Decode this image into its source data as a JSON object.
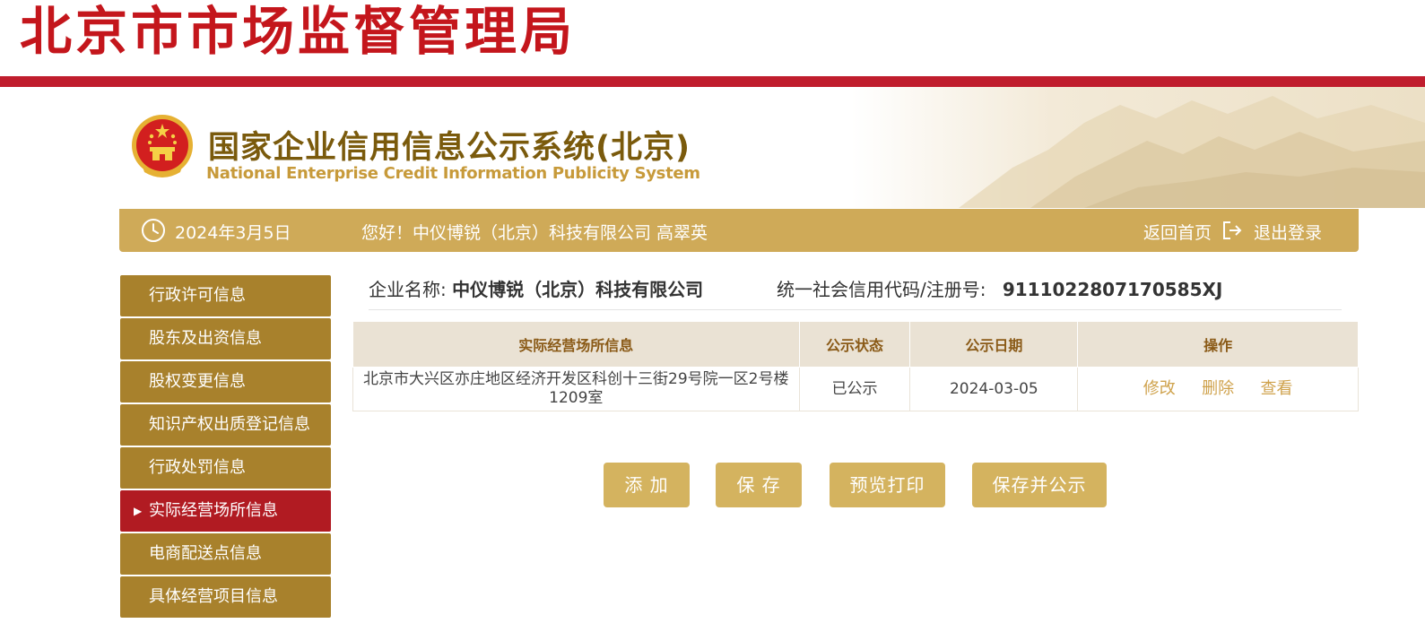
{
  "header": {
    "agency_title": "北京市市场监督管理局",
    "system_title": "国家企业信用信息公示系统(北京)",
    "system_subtitle": "National Enterprise Credit Information Publicity System"
  },
  "infobar": {
    "date": "2024年3月5日",
    "greeting": "您好！中仪博锐（北京）科技有限公司  高翠英",
    "home_link": "返回首页",
    "logout_link": "退出登录",
    "icons": [
      "clock-icon",
      "logout-icon"
    ]
  },
  "sidebar": {
    "items": [
      {
        "label": "行政许可信息"
      },
      {
        "label": "股东及出资信息"
      },
      {
        "label": "股权变更信息"
      },
      {
        "label": "知识产权出质登记信息"
      },
      {
        "label": "行政处罚信息"
      },
      {
        "label": "实际经营场所信息",
        "active": true
      },
      {
        "label": "电商配送点信息"
      },
      {
        "label": "具体经营项目信息"
      }
    ]
  },
  "company": {
    "name_label": "企业名称:",
    "name_value": "中仪博锐（北京）科技有限公司",
    "credit_label": "统一社会信用代码/注册号:",
    "credit_value": "9111022807170585XJ"
  },
  "table": {
    "headers": [
      "实际经营场所信息",
      "公示状态",
      "公示日期",
      "操作"
    ],
    "rows": [
      {
        "address": "北京市大兴区亦庄地区经济开发区科创十三街29号院一区2号楼1209室",
        "status": "已公示",
        "date": "2024-03-05",
        "actions": [
          "修改",
          "删除",
          "查看"
        ]
      }
    ]
  },
  "buttons": {
    "add": "添 加",
    "save": "保 存",
    "preview_print": "预览打印",
    "save_publish": "保存并公示"
  },
  "colors": {
    "agency_red": "#c4161c",
    "gold_bar": "#cfaa58",
    "sidebar_brown": "#a8812c",
    "active_red": "#b11b22",
    "button_gold": "#d4b35f"
  }
}
